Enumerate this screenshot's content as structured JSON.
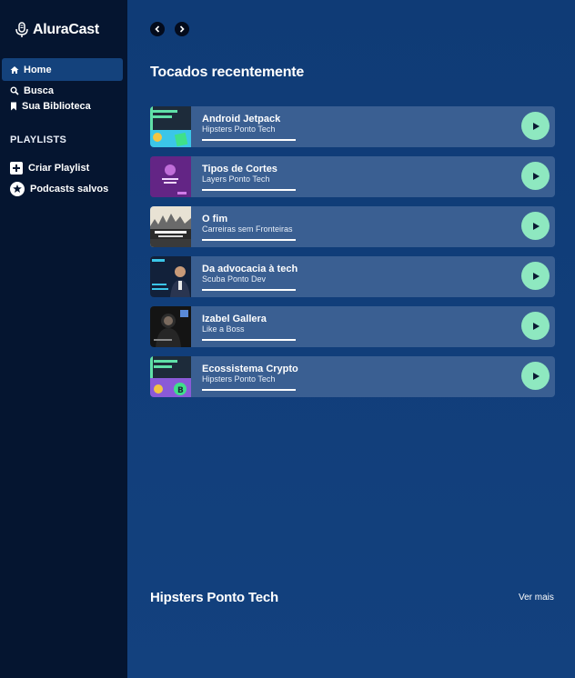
{
  "app": {
    "logo_text": "AluraCast",
    "logo_icon": "microphone-icon"
  },
  "nav": {
    "items": [
      {
        "label": "Home",
        "icon": "home-icon",
        "active": true
      },
      {
        "label": "Busca",
        "icon": "search-icon"
      },
      {
        "label": "Sua Biblioteca",
        "icon": "bookmark-icon"
      }
    ],
    "playlists_heading": "PLAYLISTS",
    "create_playlist": "Criar Playlist",
    "saved_podcasts": "Podcasts salvos"
  },
  "main": {
    "recent_title": "Tocados recentemente",
    "episodes": [
      {
        "title": "Android Jetpack",
        "subtitle": "Hipsters Ponto Tech",
        "progress": 1.0
      },
      {
        "title": "Tipos de Cortes",
        "subtitle": "Layers Ponto Tech",
        "progress": 1.0
      },
      {
        "title": "O fim",
        "subtitle": "Carreiras sem Fronteiras",
        "progress": 1.0
      },
      {
        "title": "Da advocacia à tech",
        "subtitle": "Scuba Ponto Dev",
        "progress": 1.0
      },
      {
        "title": "Izabel Gallera",
        "subtitle": "Like a Boss",
        "progress": 1.0
      },
      {
        "title": "Ecossistema Crypto",
        "subtitle": "Hipsters Ponto Tech",
        "progress": 1.0
      }
    ],
    "bottom_title": "Hipsters Ponto Tech",
    "see_more": "Ver mais"
  },
  "colors": {
    "sidebar": "#051530",
    "main": "#0f3a73",
    "card": "#3a5f92",
    "accent": "#8ee8c0",
    "active_nav": "#14427c"
  }
}
